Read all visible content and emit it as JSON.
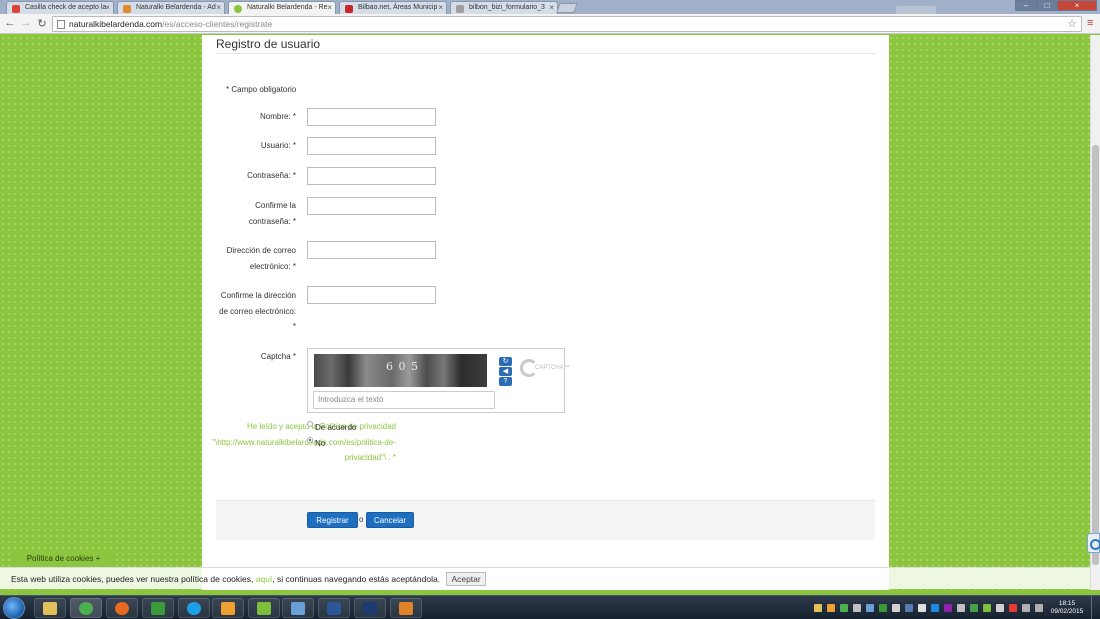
{
  "browser": {
    "tabs": [
      {
        "label": "Casilla check de acepto la",
        "favicon_color": "#d9443a"
      },
      {
        "label": "Naturalki Belardenda - Ad",
        "favicon_color": "#e08a2a"
      },
      {
        "label": "Naturalki Belardenda - Re",
        "favicon_color": "#8cc63f"
      },
      {
        "label": "Bilbao.net, Áreas Municip",
        "favicon_color": "#c62828"
      },
      {
        "label": "bilbon_bizi_formulario_3",
        "favicon_color": "#9e9e9e"
      }
    ],
    "tab_close_glyph": "×",
    "address": {
      "domain": "naturalkibelardenda.com",
      "path": "/es/acceso-clientes/registrate"
    },
    "back_glyph": "←",
    "forward_glyph": "→",
    "reload_glyph": "↻",
    "star_glyph": "☆",
    "menu_glyph": "≡",
    "window_buttons": [
      "–",
      "□",
      "×"
    ]
  },
  "page": {
    "title": "Registro de usuario",
    "required_note": "* Campo obligatorio",
    "fields": [
      {
        "label": "Nombre: *"
      },
      {
        "label": "Usuario: *"
      },
      {
        "label": "Contraseña: *"
      },
      {
        "label": "Confirme la contraseña: *"
      },
      {
        "label": "Dirección de correo electrónico: *"
      },
      {
        "label": "Confirme la dirección de correo electrónico: *"
      }
    ],
    "captcha": {
      "label": "Captcha *",
      "digits": "6 0 5",
      "placeholder": "Introduzca el texto",
      "buttons": [
        "↻",
        "◀",
        "?"
      ],
      "logo_text": "CAPTCHA™"
    },
    "accept": {
      "label": "He leído y acepto la Política de privacidad \"\\http://www.naturalkibelardenda.com/es/politica-de-privacidad\"\\ . *",
      "options": [
        {
          "label": "De acuerdo",
          "selected": false
        },
        {
          "label": "No",
          "selected": true
        }
      ]
    },
    "actions": {
      "submit": "Registrar",
      "or": "o",
      "cancel": "Cancelar"
    }
  },
  "cookies": {
    "tab_label": "Política de cookies +",
    "text_before": "Esta web utiliza cookies, puedes ver nuestra política de cookies, ",
    "link": "aquí",
    "text_after": ", si continuas navegando estás aceptándola.",
    "accept_button": "Aceptar"
  },
  "taskbar": {
    "apps": [
      {
        "name": "explorer",
        "color": "#e3c15a"
      },
      {
        "name": "chrome",
        "color": "#4caf50"
      },
      {
        "name": "firefox",
        "color": "#e66a1f"
      },
      {
        "name": "network",
        "color": "#3a9a3a"
      },
      {
        "name": "skype",
        "color": "#1ea0e6"
      },
      {
        "name": "media-player",
        "color": "#f0a030"
      },
      {
        "name": "dreamweaver",
        "color": "#7cbf3c"
      },
      {
        "name": "photo-viewer",
        "color": "#6a9fd8"
      },
      {
        "name": "word",
        "color": "#2b5797"
      },
      {
        "name": "console",
        "color": "#1c3b6e"
      },
      {
        "name": "outlook",
        "color": "#e0822a"
      }
    ],
    "clock_time": "18:15",
    "clock_date": "09/02/2015"
  }
}
